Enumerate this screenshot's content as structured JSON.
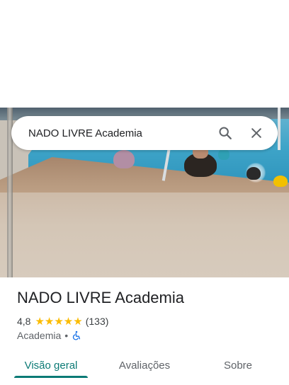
{
  "search": {
    "value": "NADO LIVRE Academia"
  },
  "icons": {
    "search": "search-icon",
    "close": "close-icon",
    "accessibility": "wheelchair-icon",
    "rating_star": "star-icon"
  },
  "place": {
    "title": "NADO LIVRE Academia",
    "rating": "4,8",
    "rating_value": 4.8,
    "stars": "★★★★★",
    "review_count": "(133)",
    "category": "Academia",
    "separator": "•"
  },
  "tabs": [
    {
      "label": "Visão geral",
      "active": true
    },
    {
      "label": "Avaliações",
      "active": false
    },
    {
      "label": "Sobre",
      "active": false
    }
  ],
  "colors": {
    "accent": "#0b7a75",
    "star": "#fbbc04",
    "accessibility": "#1a73e8"
  }
}
